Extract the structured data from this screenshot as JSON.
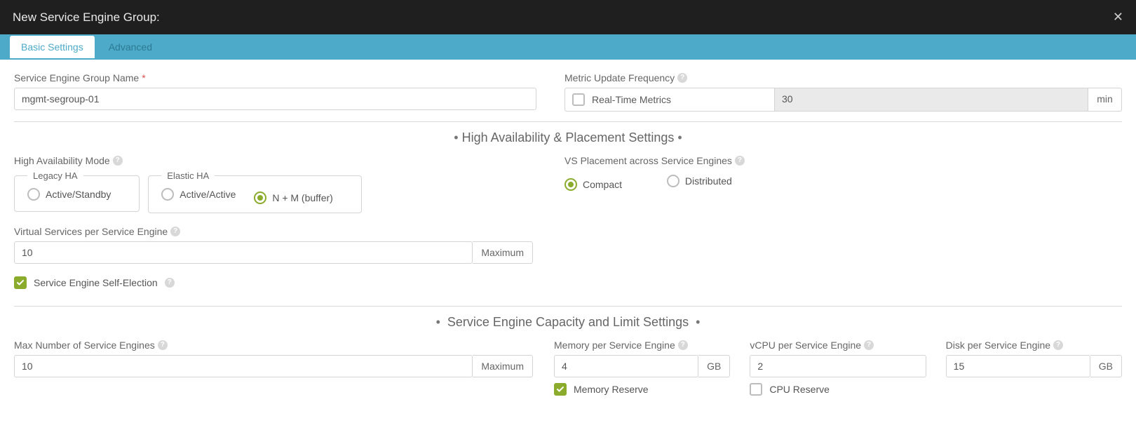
{
  "window": {
    "title": "New Service Engine Group:"
  },
  "tabs": {
    "basic": "Basic Settings",
    "advanced": "Advanced"
  },
  "segn": {
    "label": "Service Engine Group Name",
    "value": "mgmt-segroup-01"
  },
  "muf": {
    "label": "Metric Update Frequency",
    "rtm_label": "Real-Time Metrics",
    "value": "30",
    "unit": "min"
  },
  "sections": {
    "ha": "High Availability & Placement Settings",
    "cap": "Service Engine Capacity and Limit Settings"
  },
  "ham": {
    "label": "High Availability Mode",
    "legacy_legend": "Legacy HA",
    "elastic_legend": "Elastic HA",
    "opt_active_standby": "Active/Standby",
    "opt_active_active": "Active/Active",
    "opt_n_m": "N + M (buffer)"
  },
  "vsp": {
    "label": "VS Placement across Service Engines",
    "opt_compact": "Compact",
    "opt_distributed": "Distributed"
  },
  "vspse": {
    "label": "Virtual Services per Service Engine",
    "value": "10",
    "addon": "Maximum"
  },
  "selfelect": {
    "label": "Service Engine Self-Election"
  },
  "maxse": {
    "label": "Max Number of Service Engines",
    "value": "10",
    "addon": "Maximum"
  },
  "mem": {
    "label": "Memory per Service Engine",
    "value": "4",
    "unit": "GB"
  },
  "vcpu": {
    "label": "vCPU per Service Engine",
    "value": "2"
  },
  "disk": {
    "label": "Disk per Service Engine",
    "value": "15",
    "unit": "GB"
  },
  "memresv": {
    "label": "Memory Reserve"
  },
  "cpuresv": {
    "label": "CPU Reserve"
  }
}
